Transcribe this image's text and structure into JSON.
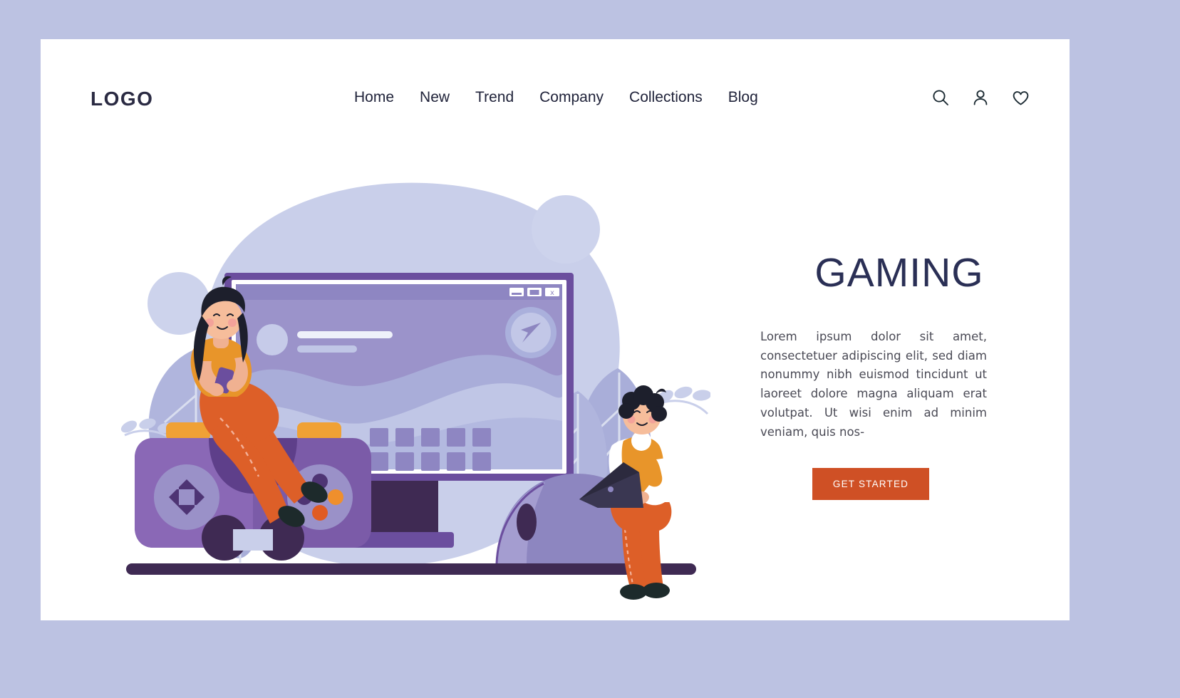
{
  "brand": {
    "logo": "LOGO"
  },
  "nav": {
    "items": [
      {
        "label": "Home"
      },
      {
        "label": "New"
      },
      {
        "label": "Trend"
      },
      {
        "label": "Company"
      },
      {
        "label": "Collections"
      },
      {
        "label": "Blog"
      }
    ]
  },
  "actions": {
    "search": "search-icon",
    "account": "user-icon",
    "wishlist": "heart-icon"
  },
  "hero": {
    "title": "GAMING",
    "paragraph": "Lorem ipsum dolor sit amet, consectetuer adipiscing elit, sed diam nonummy nibh euismod tincidunt ut laoreet dolore magna aliquam erat volutpat. Ut wisi enim ad minim veniam, quis nos-",
    "cta_label": "GET STARTED"
  },
  "illustration": {
    "name": "gaming-flat-illustration",
    "elements": [
      "monitor-with-browser-window",
      "game-controller",
      "woman-sitting-on-controller",
      "boy-with-laptop",
      "computer-mouse",
      "leaves-decoration",
      "background-blobs"
    ],
    "screen_window": {
      "minimize_control": "minimize-icon",
      "maximize_control": "maximize-icon",
      "close_control": "close-icon",
      "send_icon": "paper-plane-icon"
    }
  },
  "colors": {
    "page_background": "#bcc2e2",
    "card_background": "#ffffff",
    "text_dark": "#20233a",
    "heading": "#2a2f55",
    "accent_orange": "#cf5025",
    "purple_dark": "#6b4e9e",
    "purple_mid": "#8d86c0",
    "purple_deep": "#3f2a53",
    "lavender": "#c9cdea",
    "pale_blue": "#d6dcf2",
    "skin": "#f0b191",
    "orange_shirt": "#e8952a",
    "orange_pants": "#dd5f28",
    "hair_dark": "#1d1f2c"
  }
}
